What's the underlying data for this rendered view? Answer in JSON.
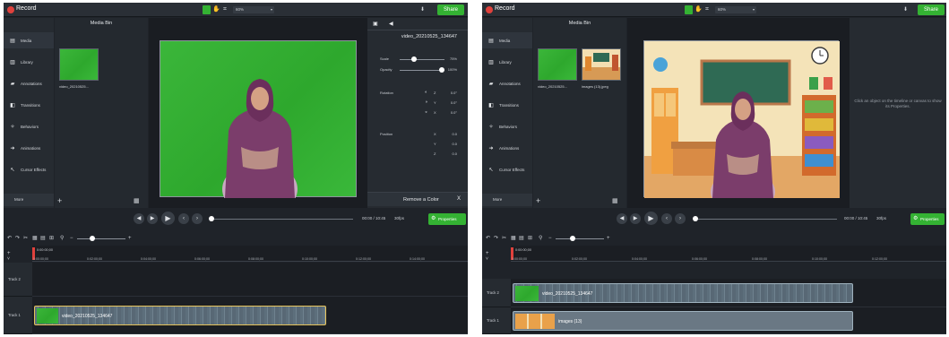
{
  "colors": {
    "accent_green": "#34b233",
    "record_red": "#e0413c",
    "panel_bg": "#1f2329",
    "green_screen": "#33ad32"
  },
  "left": {
    "app_title": "Record",
    "zoom_value": "60%",
    "share_label": "Share",
    "sidebar": {
      "items": [
        {
          "label": "Media",
          "icon": "film-icon"
        },
        {
          "label": "Library",
          "icon": "library-icon"
        },
        {
          "label": "Annotations",
          "icon": "annotation-icon"
        },
        {
          "label": "Transitions",
          "icon": "transition-icon"
        },
        {
          "label": "Behaviors",
          "icon": "behavior-icon"
        },
        {
          "label": "Animations",
          "icon": "animation-icon"
        },
        {
          "label": "Cursor Effects",
          "icon": "cursor-icon"
        }
      ],
      "more_label": "More"
    },
    "media_bin": {
      "title": "Media Bin",
      "items": [
        {
          "label": "video_20210525..."
        }
      ]
    },
    "properties": {
      "clip_name": "video_20210525_134647",
      "scale": {
        "label": "Scale",
        "value": "75%",
        "level": 0.3
      },
      "opacity": {
        "label": "Opacity",
        "value": "100%",
        "level": 1.0
      },
      "rotation": {
        "label": "Rotation",
        "rows": [
          {
            "axis": "Z",
            "value": "0.0°"
          },
          {
            "axis": "Y",
            "value": "0.0°"
          },
          {
            "axis": "X",
            "value": "0.0°"
          }
        ]
      },
      "position": {
        "label": "Position",
        "rows": [
          {
            "axis": "X",
            "value": "0.0"
          },
          {
            "axis": "Y",
            "value": "0.0"
          },
          {
            "axis": "Z",
            "value": "0.0"
          }
        ]
      },
      "remove_color": "Remove a Color",
      "close": "X"
    },
    "player": {
      "time": "00:00 / 10:45",
      "fps": "30fps",
      "properties_label": "Properties"
    },
    "timeline": {
      "playhead_time": "0:00:00;00",
      "ruler": [
        "0:00:00;00",
        "0:02:00;00",
        "0:04:00;00",
        "0:06:00;00",
        "0:08:00;00",
        "0:10:00;00",
        "0:12:00;00",
        "0:14:00;00"
      ],
      "tracks": [
        {
          "name": "Track 2",
          "clip": ""
        },
        {
          "name": "Track 1",
          "clip": "video_20210525_134647"
        }
      ]
    }
  },
  "right": {
    "app_title": "Record",
    "zoom_value": "60%",
    "share_label": "Share",
    "sidebar": {
      "items": [
        {
          "label": "Media",
          "icon": "film-icon"
        },
        {
          "label": "Library",
          "icon": "library-icon"
        },
        {
          "label": "Annotations",
          "icon": "annotation-icon"
        },
        {
          "label": "Transitions",
          "icon": "transition-icon"
        },
        {
          "label": "Behaviors",
          "icon": "behavior-icon"
        },
        {
          "label": "Animations",
          "icon": "animation-icon"
        },
        {
          "label": "Cursor Effects",
          "icon": "cursor-icon"
        }
      ],
      "more_label": "More"
    },
    "media_bin": {
      "title": "Media Bin",
      "items": [
        {
          "label": "video_20210525..."
        },
        {
          "label": "images (13).jpeg"
        }
      ]
    },
    "properties_hint": "Click an object on the timeline or canvas to show its Properties.",
    "player": {
      "time": "00:00 / 10:45",
      "fps": "30fps",
      "properties_label": "Properties"
    },
    "timeline": {
      "playhead_time": "0:00:00;00",
      "ruler": [
        "0:00:00;00",
        "0:02:00;00",
        "0:04:00;00",
        "0:06:00;00",
        "0:08:00;00",
        "0:10:00;00",
        "0:12:00;00"
      ],
      "tracks": [
        {
          "name": "Track 2",
          "clip": "video_20210525_134647"
        },
        {
          "name": "Track 1",
          "clip": "images (13)"
        }
      ]
    }
  }
}
